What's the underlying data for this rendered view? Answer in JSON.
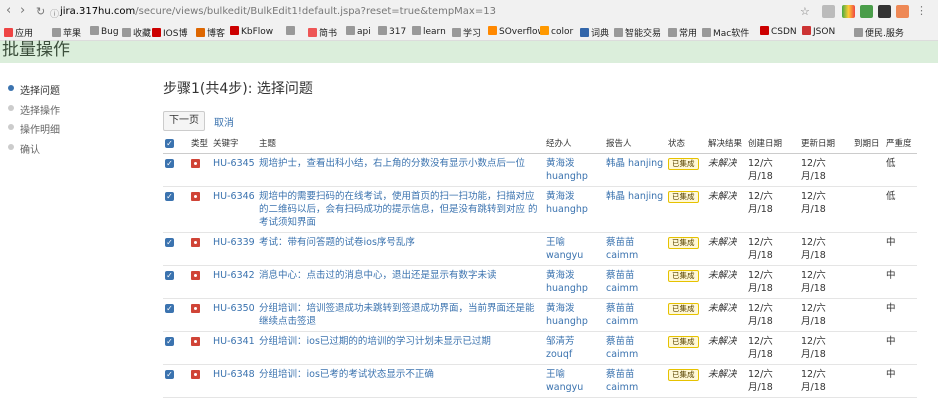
{
  "browser": {
    "url_host": "jira.317hu.com",
    "url_path": "/secure/views/bulkedit/BulkEdit1!default.jspa?reset=true&tempMax=13"
  },
  "bookmarks": [
    {
      "label": "应用",
      "color": "#e44"
    },
    {
      "label": "苹果",
      "color": "#999"
    },
    {
      "label": "Bug",
      "color": "#999"
    },
    {
      "label": "收藏",
      "color": "#999"
    },
    {
      "label": "IOS博",
      "color": "#c00"
    },
    {
      "label": "博客",
      "color": "#d60"
    },
    {
      "label": "KbFlow",
      "color": "#c00"
    },
    {
      "label": "",
      "color": "#999"
    },
    {
      "label": "简书",
      "color": "#e55"
    },
    {
      "label": "api",
      "color": "#999"
    },
    {
      "label": "317",
      "color": "#999"
    },
    {
      "label": "learn",
      "color": "#999"
    },
    {
      "label": "学习",
      "color": "#999"
    },
    {
      "label": "SOverflow",
      "color": "#f80"
    },
    {
      "label": "color",
      "color": "#f90"
    },
    {
      "label": "词典",
      "color": "#36a"
    },
    {
      "label": "智能交易",
      "color": "#999"
    },
    {
      "label": "常用",
      "color": "#999"
    },
    {
      "label": "Mac软件",
      "color": "#999"
    },
    {
      "label": "CSDN",
      "color": "#c00"
    },
    {
      "label": "JSON",
      "color": "#c33"
    },
    {
      "label": "便民.服务",
      "color": "#999"
    }
  ],
  "header": {
    "title": "批量操作"
  },
  "sidebar": {
    "steps": [
      {
        "label": "选择问题",
        "active": true
      },
      {
        "label": "选择操作",
        "active": false
      },
      {
        "label": "操作明细",
        "active": false
      },
      {
        "label": "确认",
        "active": false
      }
    ]
  },
  "main": {
    "title": "步骤1(共4步): 选择问题",
    "next_button": "下一页",
    "cancel_link": "取消"
  },
  "table": {
    "headers": [
      "",
      "类型",
      "关键字",
      "主题",
      "经办人",
      "报告人",
      "状态",
      "解决结果",
      "创建日期",
      "更新日期",
      "到期日",
      "严重度"
    ],
    "rows": [
      {
        "key": "HU-6345",
        "summary": "规培护士，查看出科小结，右上角的分数没有显示小数点后一位",
        "assignee": "黄海泼",
        "assignee_id": "huanghp",
        "reporter": "韩晶 hanjing",
        "reporter_id": "",
        "status": "已集成",
        "resolution": "未解决",
        "created": "12/六月/18",
        "updated": "12/六月/18",
        "due": "",
        "severity": "低"
      },
      {
        "key": "HU-6346",
        "summary": "规培中的需要扫码的在线考试，使用首页的扫一扫功能，扫描对应的二维码以后，会有扫码成功的提示信息，但是没有跳转到对应 的考试须知界面",
        "assignee": "黄海泼",
        "assignee_id": "huanghp",
        "reporter": "韩晶 hanjing",
        "reporter_id": "",
        "status": "已集成",
        "resolution": "未解决",
        "created": "12/六月/18",
        "updated": "12/六月/18",
        "due": "",
        "severity": "低"
      },
      {
        "key": "HU-6339",
        "summary": "考试：带有问答题的试卷ios序号乱序",
        "assignee": "王喻",
        "assignee_id": "wangyu",
        "reporter": "蔡苗苗",
        "reporter_id": "caimm",
        "status": "已集成",
        "resolution": "未解决",
        "created": "12/六月/18",
        "updated": "12/六月/18",
        "due": "",
        "severity": "中"
      },
      {
        "key": "HU-6342",
        "summary": "消息中心：点击过的消息中心，退出还是显示有数字未读",
        "assignee": "黄海泼",
        "assignee_id": "huanghp",
        "reporter": "蔡苗苗",
        "reporter_id": "caimm",
        "status": "已集成",
        "resolution": "未解决",
        "created": "12/六月/18",
        "updated": "12/六月/18",
        "due": "",
        "severity": "中"
      },
      {
        "key": "HU-6350",
        "summary": "分组培训：培训签退成功未跳转到签退成功界面，当前界面还是能继续点击签退",
        "assignee": "黄海泼",
        "assignee_id": "huanghp",
        "reporter": "蔡苗苗",
        "reporter_id": "caimm",
        "status": "已集成",
        "resolution": "未解决",
        "created": "12/六月/18",
        "updated": "12/六月/18",
        "due": "",
        "severity": "中"
      },
      {
        "key": "HU-6341",
        "summary": "分组培训：ios已过期的的培训的学习计划未显示已过期",
        "assignee": "邹清芳",
        "assignee_id": "zouqf",
        "reporter": "蔡苗苗",
        "reporter_id": "caimm",
        "status": "已集成",
        "resolution": "未解决",
        "created": "12/六月/18",
        "updated": "12/六月/18",
        "due": "",
        "severity": "中"
      },
      {
        "key": "HU-6348",
        "summary": "分组培训：ios已考的考试状态显示不正确",
        "assignee": "王喻",
        "assignee_id": "wangyu",
        "reporter": "蔡苗苗",
        "reporter_id": "caimm",
        "status": "已集成",
        "resolution": "未解决",
        "created": "12/六月/18",
        "updated": "12/六月/18",
        "due": "",
        "severity": "中"
      }
    ]
  },
  "colors": {
    "accent": "#3b73af",
    "header_bg": "#dbeedb",
    "bug_red": "#d04437"
  }
}
